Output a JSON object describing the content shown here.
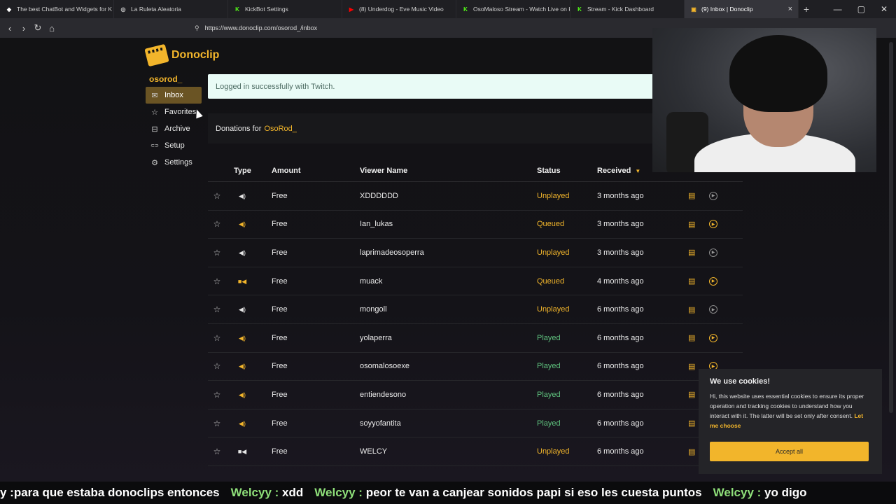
{
  "browser": {
    "tabs": [
      {
        "title": "The best ChatBot and Widgets for K",
        "color": "#ffffff",
        "glyph": "◆"
      },
      {
        "title": "La Ruleta Aleatoria",
        "color": "#cccccc",
        "glyph": "◎"
      },
      {
        "title": "KickBot Settings",
        "color": "#53fc18",
        "glyph": "K"
      },
      {
        "title": "(8) Underdog - Eve Music Video",
        "color": "#ff0000",
        "glyph": "▶"
      },
      {
        "title": "OsoMaloso Stream - Watch Live on K",
        "color": "#53fc18",
        "glyph": "K"
      },
      {
        "title": "Stream - Kick Dashboard",
        "color": "#53fc18",
        "glyph": "K"
      },
      {
        "title": "(9) Inbox | Donoclip",
        "color": "#f2b52b",
        "glyph": "▣"
      }
    ],
    "url": "https://www.donoclip.com/osorod_/inbox"
  },
  "app": {
    "brand": "Donoclip",
    "username": "osorod_",
    "sidebar": [
      {
        "label": "Inbox",
        "icon": "inbox-icon",
        "glyph": "✉",
        "active": true
      },
      {
        "label": "Favorites",
        "icon": "star-icon",
        "glyph": "☆",
        "active": false
      },
      {
        "label": "Archive",
        "icon": "archive-icon",
        "glyph": "⊟",
        "active": false
      },
      {
        "label": "Setup",
        "icon": "link-icon",
        "glyph": "⊂⊃",
        "active": false
      },
      {
        "label": "Settings",
        "icon": "gear-icon",
        "glyph": "⚙",
        "active": false
      }
    ],
    "notice": "Logged in successfully with Twitch.",
    "donations_prefix": "Donations for",
    "donations_user": "OsoRod_",
    "table": {
      "headers": {
        "type": "Type",
        "amount": "Amount",
        "viewer": "Viewer Name",
        "status": "Status",
        "received": "Received"
      },
      "rows": [
        {
          "type": "sound",
          "amount": "Free",
          "viewer": "XDDDDDD",
          "status": "Unplayed",
          "received": "3 months ago",
          "play_active": false
        },
        {
          "type": "sound-gold",
          "amount": "Free",
          "viewer": "Ian_lukas",
          "status": "Queued",
          "received": "3 months ago",
          "play_active": true
        },
        {
          "type": "sound",
          "amount": "Free",
          "viewer": "laprimadeosoperra",
          "status": "Unplayed",
          "received": "3 months ago",
          "play_active": false
        },
        {
          "type": "video-gold",
          "amount": "Free",
          "viewer": "muack",
          "status": "Queued",
          "received": "4 months ago",
          "play_active": true
        },
        {
          "type": "sound",
          "amount": "Free",
          "viewer": "mongoll",
          "status": "Unplayed",
          "received": "6 months ago",
          "play_active": false
        },
        {
          "type": "sound-gold",
          "amount": "Free",
          "viewer": "yolaperra",
          "status": "Played",
          "received": "6 months ago",
          "play_active": true
        },
        {
          "type": "sound-gold",
          "amount": "Free",
          "viewer": "osomalosoexe",
          "status": "Played",
          "received": "6 months ago",
          "play_active": true
        },
        {
          "type": "sound-gold",
          "amount": "Free",
          "viewer": "entiendesono",
          "status": "Played",
          "received": "6 months ago",
          "play_active": true
        },
        {
          "type": "sound-gold",
          "amount": "Free",
          "viewer": "soyyofantita",
          "status": "Played",
          "received": "6 months ago",
          "play_active": true
        },
        {
          "type": "video",
          "amount": "Free",
          "viewer": "WELCY",
          "status": "Unplayed",
          "received": "6 months ago",
          "play_active": false
        }
      ]
    }
  },
  "cookie": {
    "title": "We use cookies!",
    "text": "Hi, this website uses essential cookies to ensure its proper operation and tracking cookies to understand how you interact with it. The latter will be set only after consent.",
    "link": "Let me choose",
    "button": "Accept all"
  },
  "ticker": [
    {
      "name": "",
      "msg": "y :para que estaba donoclips entonces"
    },
    {
      "name": "Welcyy :",
      "msg": "xdd"
    },
    {
      "name": "Welcyy :",
      "msg": "peor te van a canjear sonidos papi si eso les cuesta puntos"
    },
    {
      "name": "Welcyy :",
      "msg": "yo digo"
    }
  ],
  "colors": {
    "accent": "#f2b52b",
    "played": "#5fc27e",
    "notice_bg": "#e9fbf6"
  }
}
